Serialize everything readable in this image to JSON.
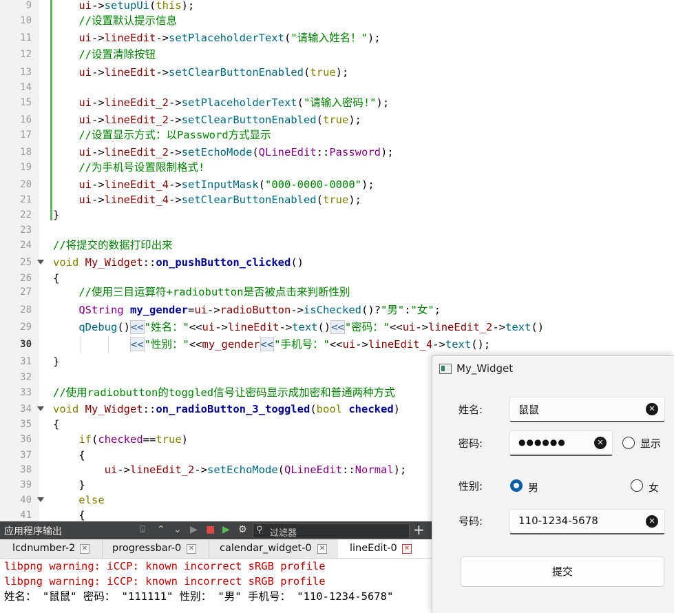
{
  "editor": {
    "lines": [
      {
        "n": "9",
        "code": "    ui->setupUi(this);"
      },
      {
        "n": "10",
        "code": "    //设置默认提示信息"
      },
      {
        "n": "11",
        "code": "    ui->lineEdit->setPlaceholderText(\"请输入姓名！\");"
      },
      {
        "n": "12",
        "code": "    //设置清除按钮"
      },
      {
        "n": "13",
        "code": "    ui->lineEdit->setClearButtonEnabled(true);"
      },
      {
        "n": "14",
        "code": ""
      },
      {
        "n": "15",
        "code": "    ui->lineEdit_2->setPlaceholderText(\"请输入密码!\");"
      },
      {
        "n": "16",
        "code": "    ui->lineEdit_2->setClearButtonEnabled(true);"
      },
      {
        "n": "17",
        "code": "    //设置显示方式：以Password方式显示"
      },
      {
        "n": "18",
        "code": "    ui->lineEdit_2->setEchoMode(QLineEdit::Password);"
      },
      {
        "n": "19",
        "code": "    //为手机号设置限制格式!"
      },
      {
        "n": "20",
        "code": "    ui->lineEdit_4->setInputMask(\"000-0000-0000\");"
      },
      {
        "n": "21",
        "code": "    ui->lineEdit_4->setClearButtonEnabled(true);"
      },
      {
        "n": "22",
        "code": "}"
      },
      {
        "n": "23",
        "code": ""
      },
      {
        "n": "24",
        "code": "//将提交的数据打印出来"
      },
      {
        "n": "25",
        "code": "void My_Widget::on_pushButton_clicked()"
      },
      {
        "n": "26",
        "code": "{"
      },
      {
        "n": "27",
        "code": "    //使用三目运算符+radiobutton是否被点击来判断性别"
      },
      {
        "n": "28",
        "code": "    QString my_gender=ui->radioButton->isChecked()?\"男\":\"女\";"
      },
      {
        "n": "29",
        "code": "    qDebug()<<\"姓名：\"<<ui->lineEdit->text()<<\"密码：\"<<ui->lineEdit_2->text()"
      },
      {
        "n": "30",
        "code": "            <<\"性别：\"<<my_gender<<\"手机号：\"<<ui->lineEdit_4->text();"
      },
      {
        "n": "31",
        "code": "}"
      },
      {
        "n": "32",
        "code": ""
      },
      {
        "n": "33",
        "code": "//使用radiobutton的toggled信号让密码显示成加密和普通两种方式"
      },
      {
        "n": "34",
        "code": "void My_Widget::on_radioButton_3_toggled(bool checked)"
      },
      {
        "n": "35",
        "code": "{"
      },
      {
        "n": "36",
        "code": "    if(checked==true)"
      },
      {
        "n": "37",
        "code": "    {"
      },
      {
        "n": "38",
        "code": "        ui->lineEdit_2->setEchoMode(QLineEdit::Normal);"
      },
      {
        "n": "39",
        "code": "    }"
      },
      {
        "n": "40",
        "code": "    else"
      },
      {
        "n": "41",
        "code": "    {"
      }
    ]
  },
  "output": {
    "title": "应用程序输出",
    "filter_placeholder": "过滤器",
    "tabs": [
      "lcdnumber-2",
      "progressbar-0",
      "calendar_widget-0",
      "lineEdit-0"
    ],
    "active_tab": "lineEdit-0",
    "log": [
      {
        "text": "libpng warning: iCCP: known incorrect sRGB profile",
        "kind": "warning"
      },
      {
        "text": "libpng warning: iCCP: known incorrect sRGB profile",
        "kind": "warning"
      },
      {
        "text": "姓名： \"鼠鼠\" 密码： \"111111\" 性别： \"男\" 手机号： \"110-1234-5678\"",
        "kind": "info"
      }
    ]
  },
  "widget": {
    "title": "My_Widget",
    "name_label": "姓名:",
    "name_value": "鼠鼠",
    "password_label": "密码:",
    "password_value": "●●●●●●",
    "show_label": "显示",
    "gender_label": "性别:",
    "male_label": "男",
    "female_label": "女",
    "phone_label": "号码:",
    "phone_value": "110-1234-5678",
    "submit_label": "提交",
    "male_checked": true,
    "female_checked": false,
    "show_checked": false
  }
}
